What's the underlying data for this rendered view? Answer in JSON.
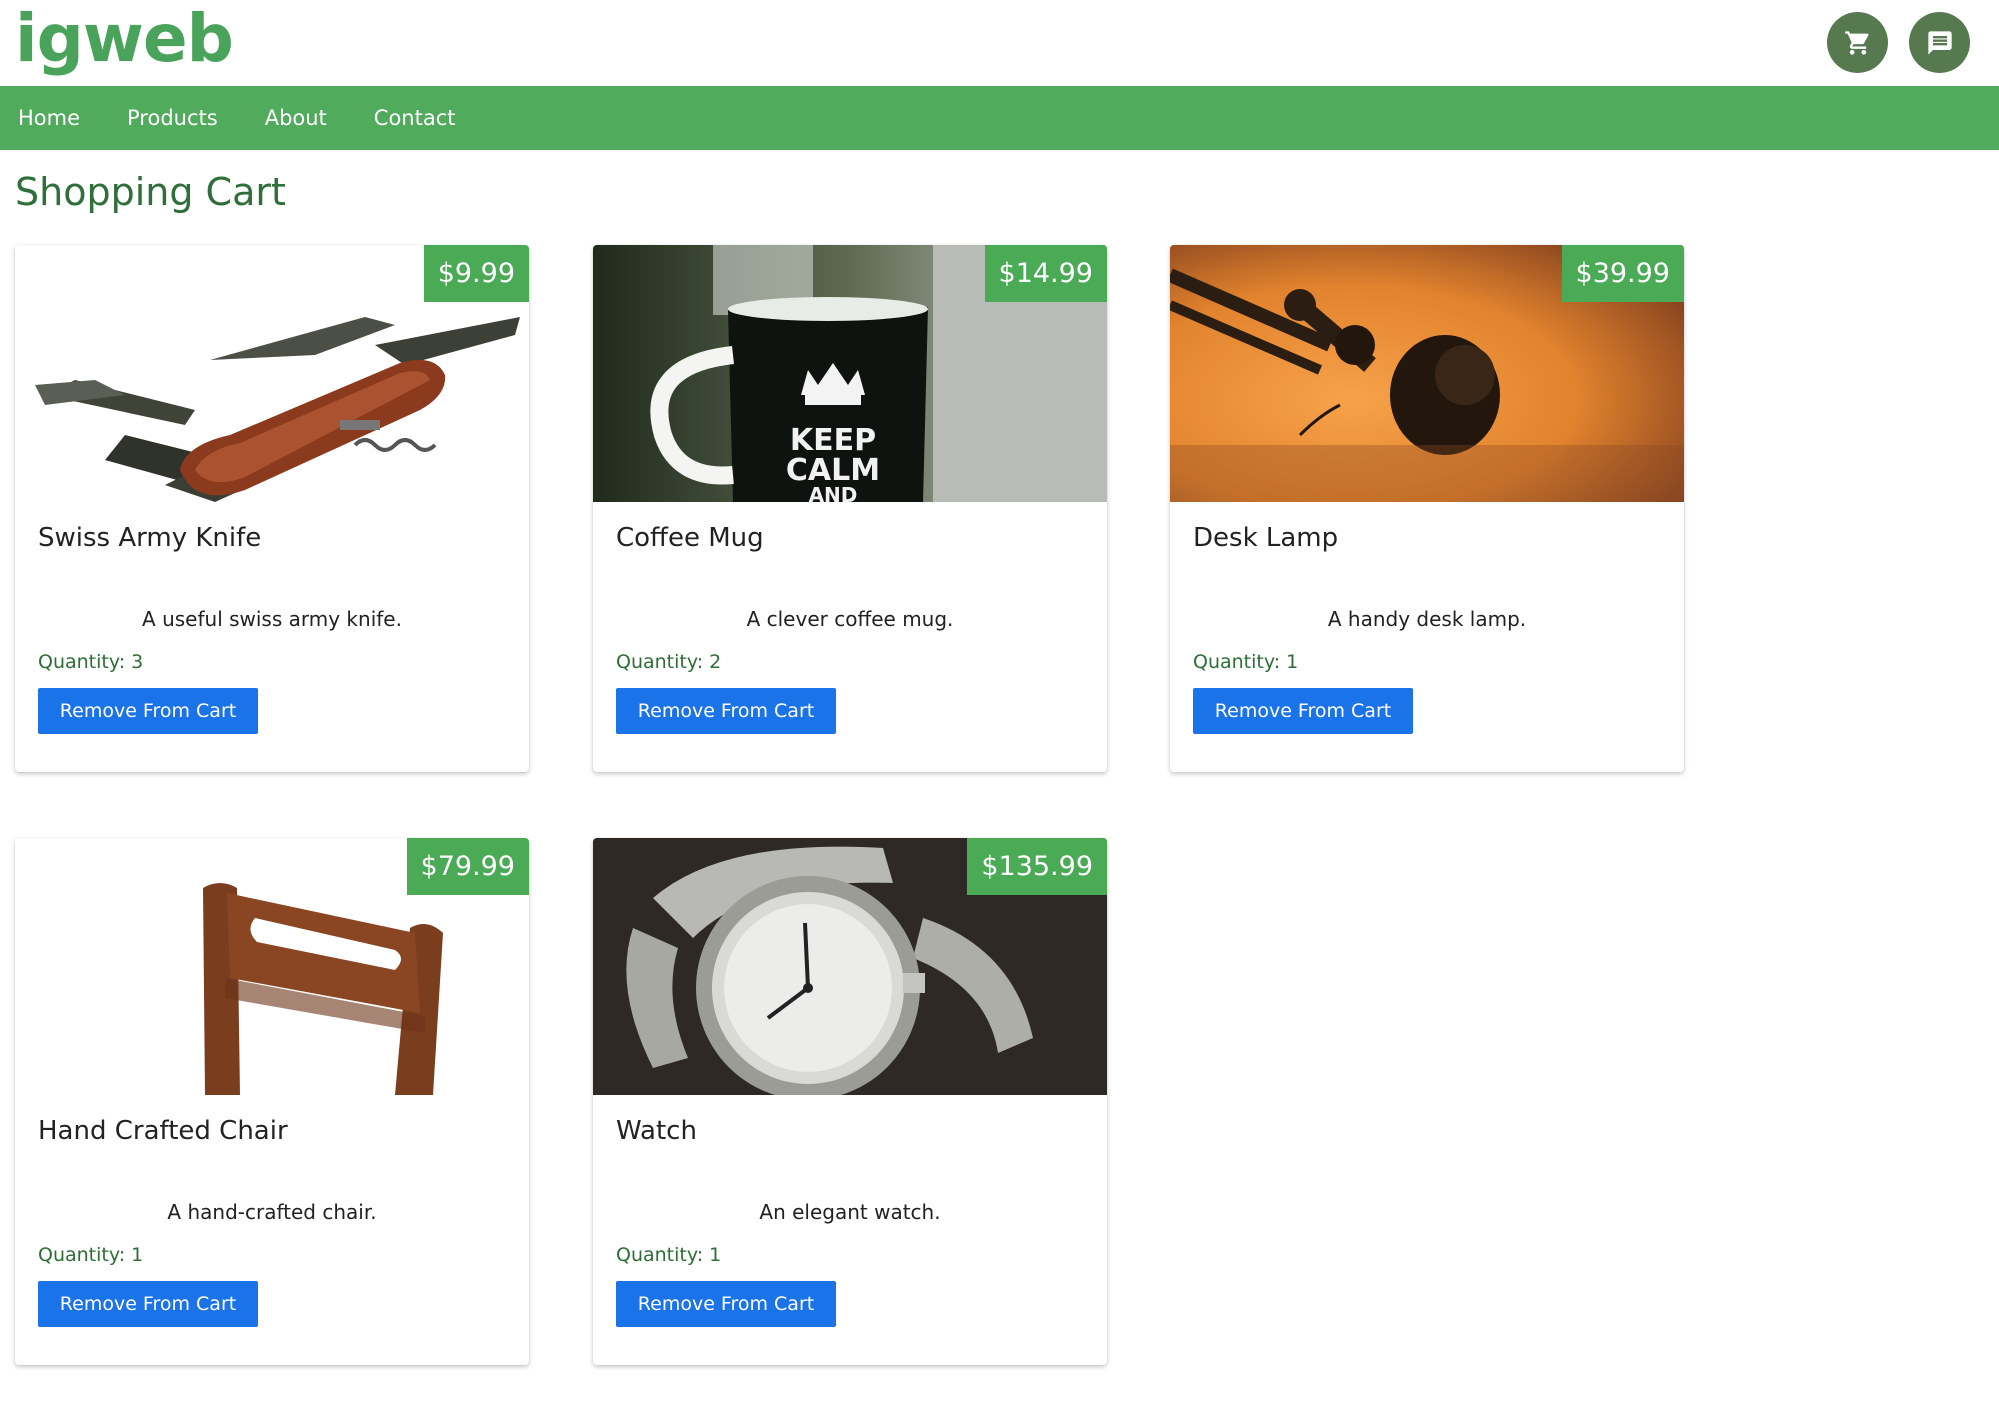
{
  "header": {
    "logo": "igweb",
    "cart_icon": "cart-icon",
    "chat_icon": "chat-icon",
    "icon_bg_color": "#56794f"
  },
  "nav": {
    "items": [
      {
        "label": "Home"
      },
      {
        "label": "Products"
      },
      {
        "label": "About"
      },
      {
        "label": "Contact"
      }
    ],
    "bg_color": "#51ab5c"
  },
  "page": {
    "title": "Shopping Cart"
  },
  "cart": {
    "quantity_label": "Quantity:",
    "remove_label": "Remove From Cart",
    "items": [
      {
        "name": "Swiss Army Knife",
        "price": "$9.99",
        "description": "A useful swiss army knife.",
        "quantity_text": "Quantity: 3",
        "quantity": 3
      },
      {
        "name": "Coffee Mug",
        "price": "$14.99",
        "description": "A clever coffee mug.",
        "quantity_text": "Quantity: 2",
        "quantity": 2
      },
      {
        "name": "Desk Lamp",
        "price": "$39.99",
        "description": "A handy desk lamp.",
        "quantity_text": "Quantity: 1",
        "quantity": 1
      },
      {
        "name": "Hand Crafted Chair",
        "price": "$79.99",
        "description": "A hand-crafted chair.",
        "quantity_text": "Quantity: 1",
        "quantity": 1
      },
      {
        "name": "Watch",
        "price": "$135.99",
        "description": "An elegant watch.",
        "quantity_text": "Quantity: 1",
        "quantity": 1
      }
    ],
    "mug_text": [
      "KEEP",
      "CALM",
      "AND"
    ]
  },
  "colors": {
    "accent_green": "#4aaa56",
    "button_blue": "#1a73e8",
    "title_green": "#2f6f3a"
  }
}
